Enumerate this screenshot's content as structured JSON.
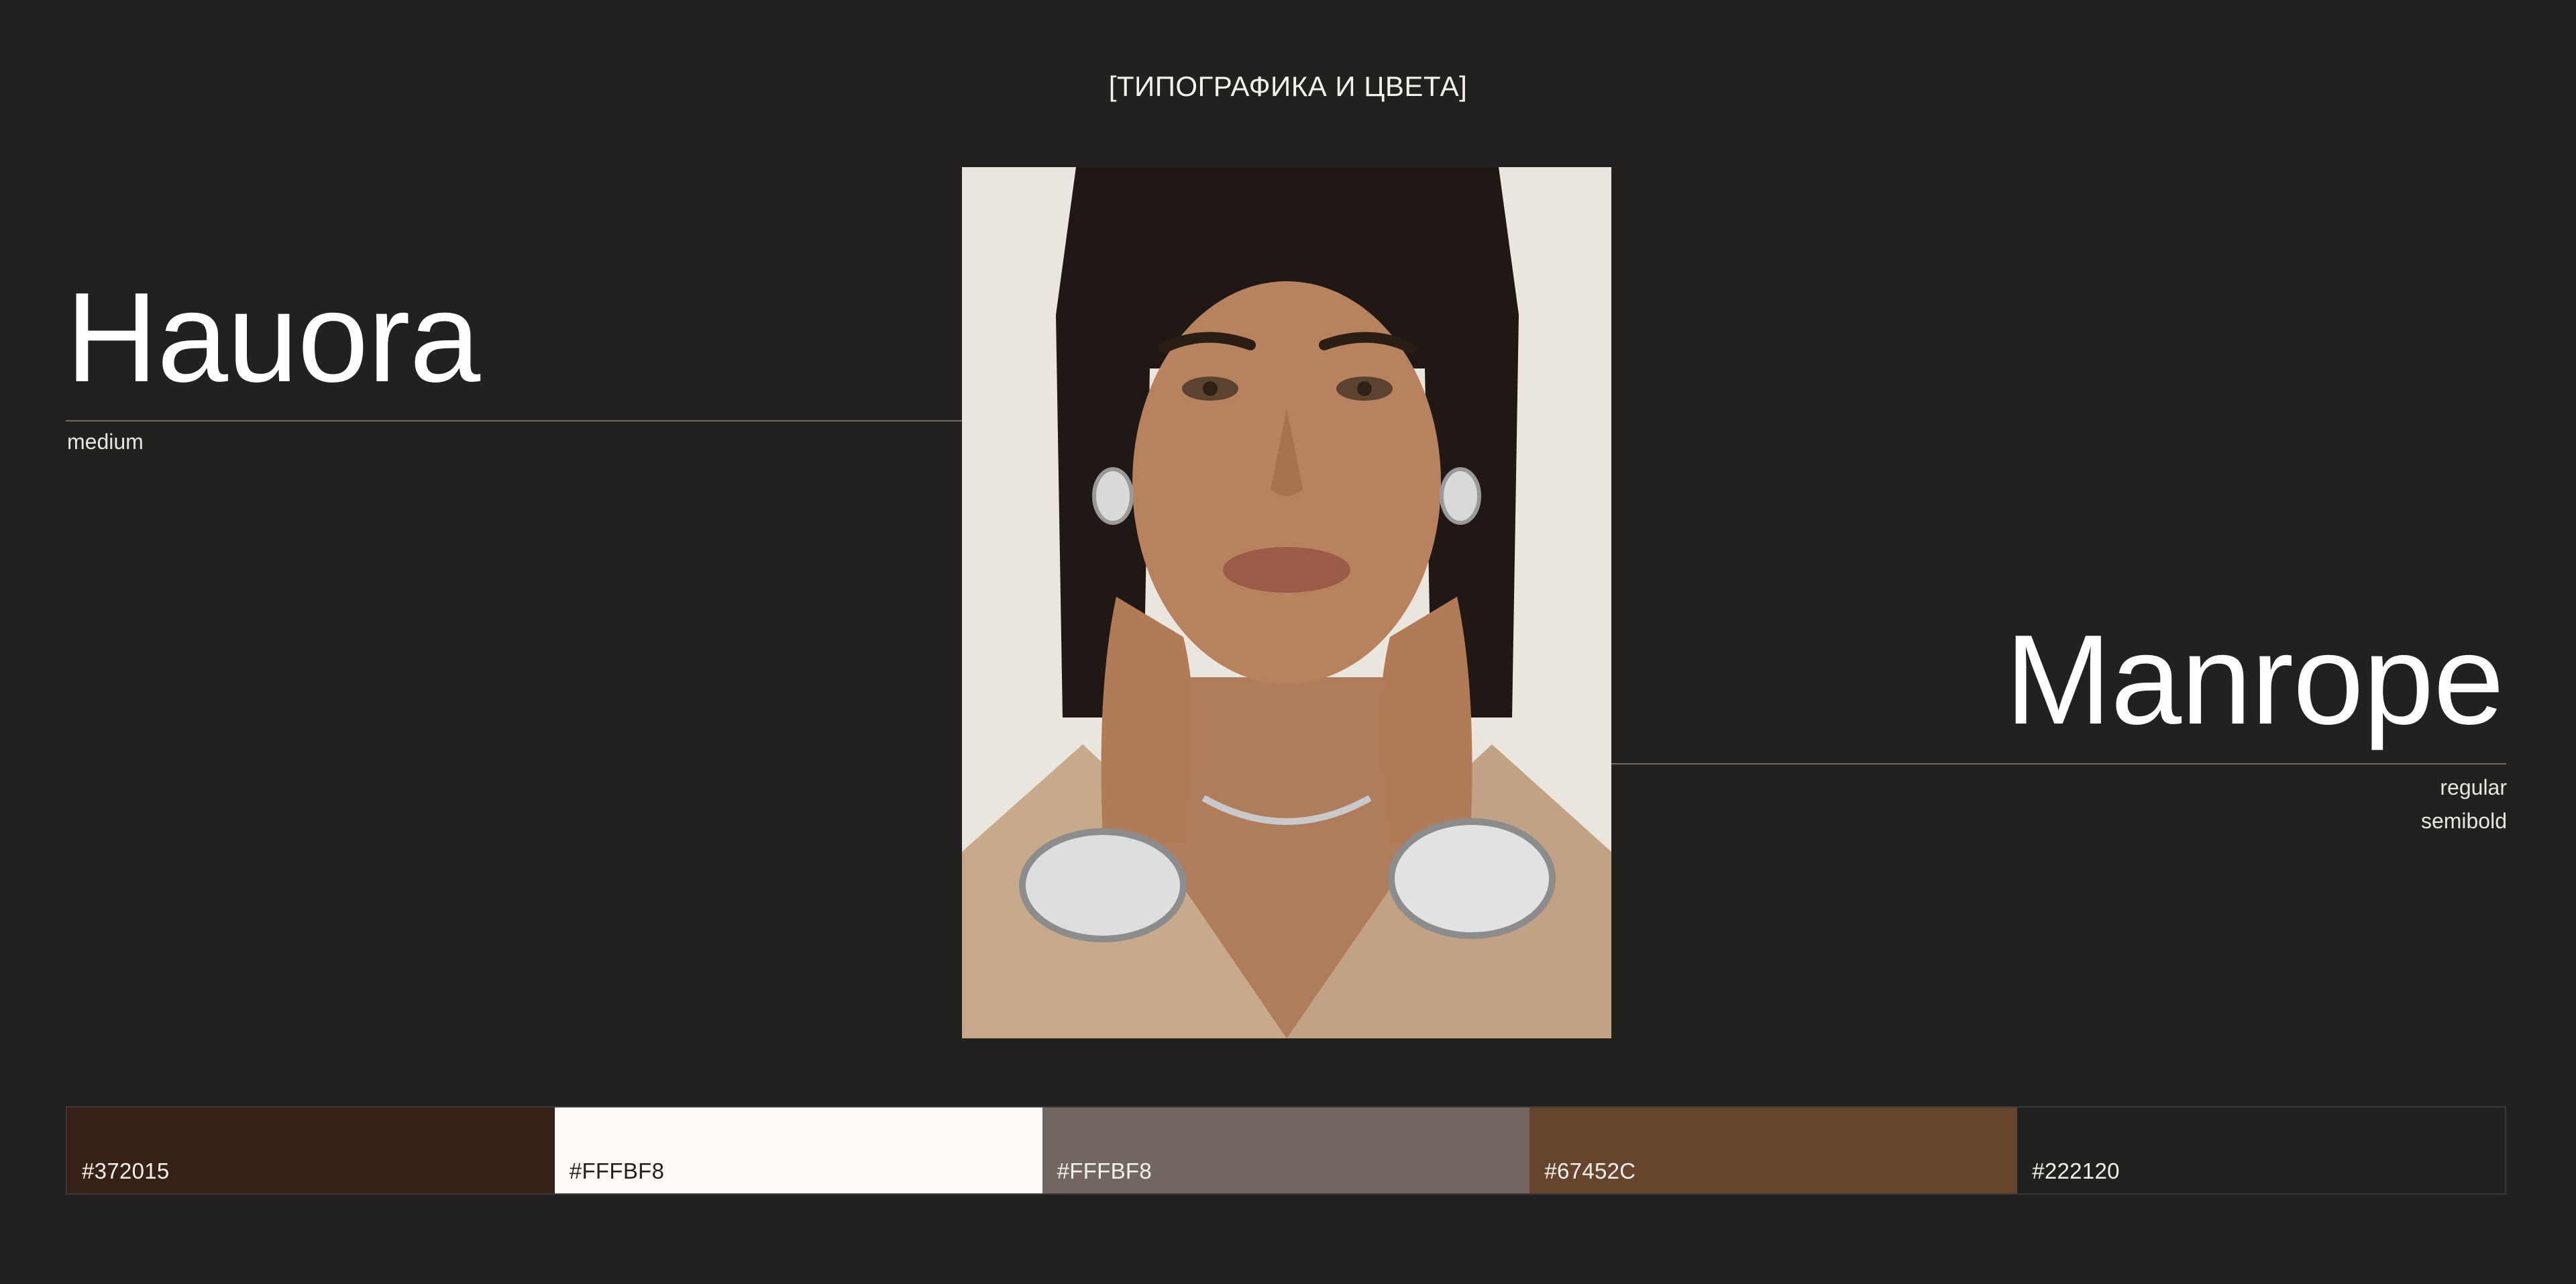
{
  "section_title": "[ТИПОГРАФИКА И ЦВЕТА]",
  "fonts": {
    "primary": {
      "name": "Hauora",
      "weights": [
        "medium"
      ]
    },
    "secondary": {
      "name": "Manrope",
      "weights": [
        "regular",
        "semibold"
      ]
    }
  },
  "photo": {
    "icon": "portrait-photo"
  },
  "palette": [
    {
      "label": "#372015",
      "color": "#372015",
      "tone": "dark"
    },
    {
      "label": "#FFFBF8",
      "color": "#FFFBF8",
      "tone": "light"
    },
    {
      "label": "#FFFBF8",
      "color": "#716660",
      "tone": "dark"
    },
    {
      "label": "#67452C",
      "color": "#67452C",
      "tone": "dark"
    },
    {
      "label": "#222120",
      "color": "#222120",
      "tone": "dark"
    }
  ]
}
